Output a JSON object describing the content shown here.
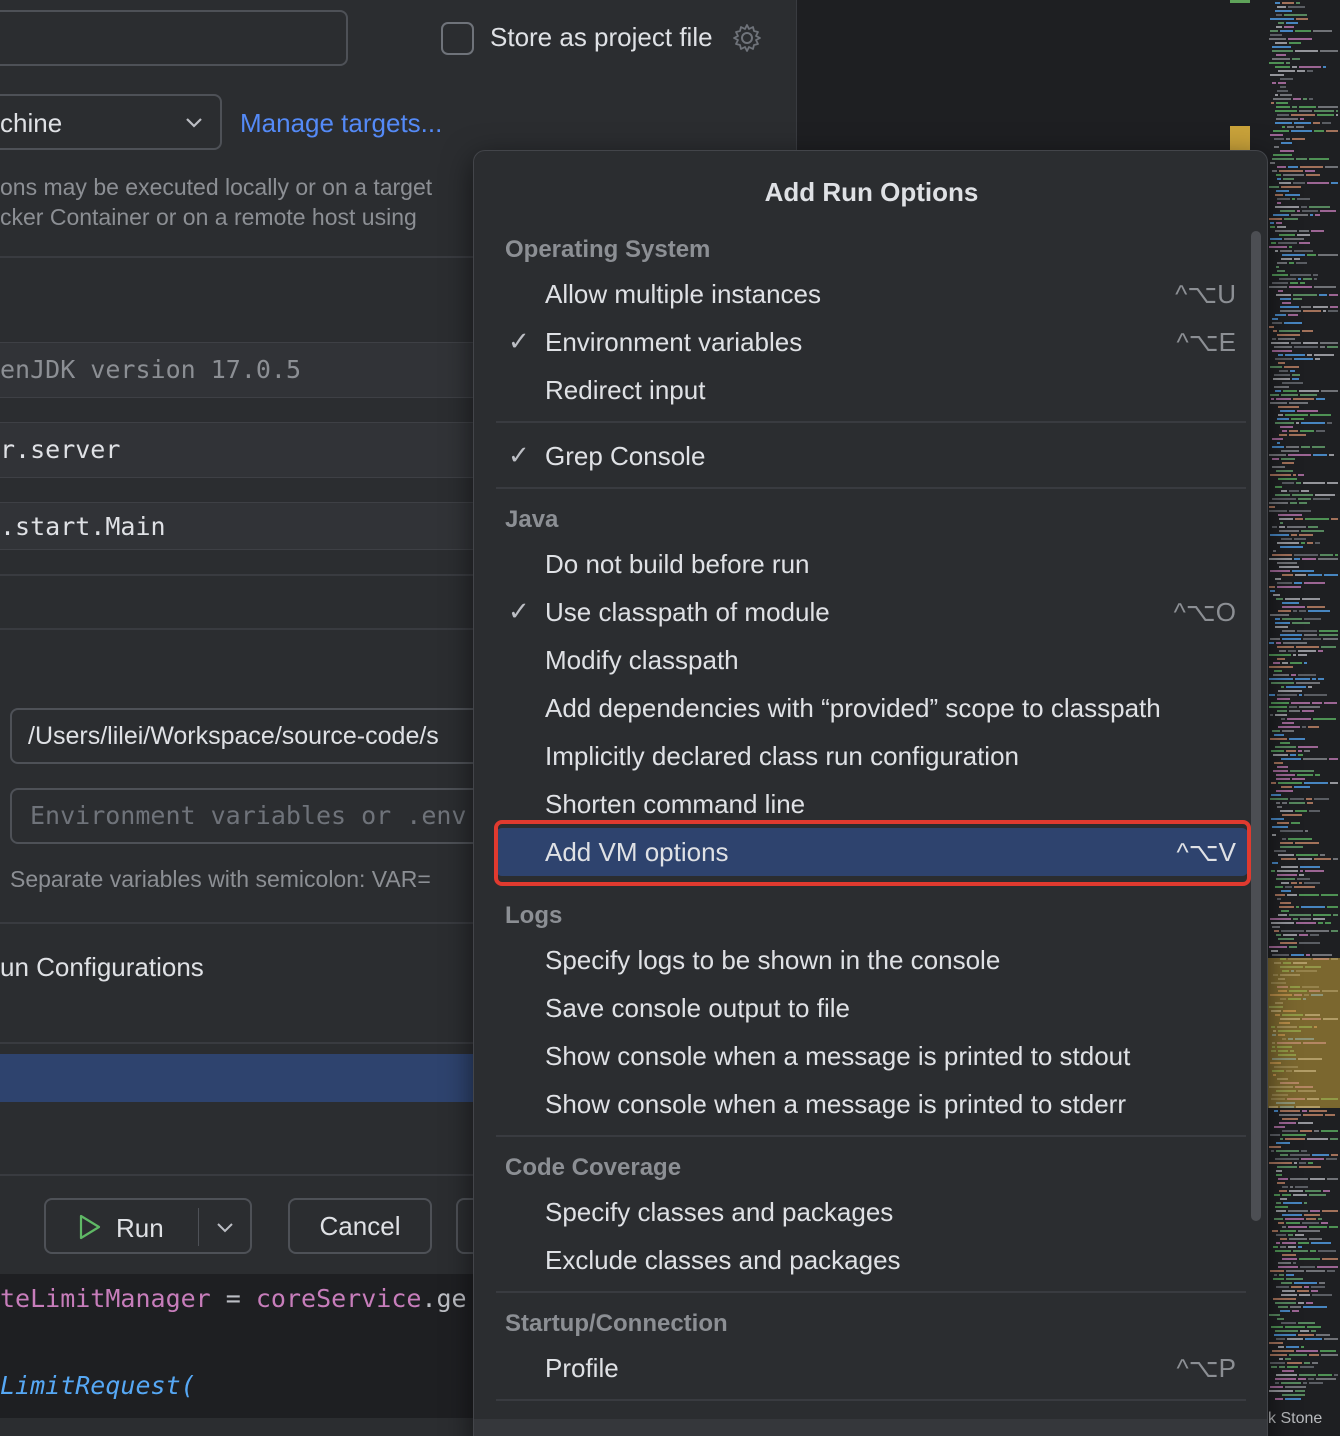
{
  "dialog": {
    "store_label": "Store as project file",
    "target_value": "chine",
    "manage_link": "Manage targets...",
    "desc_line1": "ons may be executed locally or on a target",
    "desc_line2": "cker Container or on a remote host using",
    "jdk": "enJDK version 17.0.5",
    "module": "r.server",
    "main_class": ".start.Main",
    "working_dir": "/Users/lilei/Workspace/source-code/s",
    "env_placeholder": "Environment variables or .env",
    "env_hint": "Separate variables with semicolon: VAR=",
    "run_configs_label": "un Configurations",
    "run_label": "Run",
    "cancel_label": "Cancel"
  },
  "editor": {
    "line1_field": "teLimitManager",
    "line1_op": " = ",
    "line1_call": "coreService",
    "line1_rest": ".ge",
    "line2": "LimitRequest("
  },
  "popup": {
    "title": "Add Run Options",
    "groups": {
      "os": "Operating System",
      "java": "Java",
      "logs": "Logs",
      "coverage": "Code Coverage",
      "startup": "Startup/Connection"
    },
    "items": {
      "allow_multiple": {
        "label": "Allow multiple instances",
        "shortcut": "^⌥U",
        "checked": false
      },
      "env_vars": {
        "label": "Environment variables",
        "shortcut": "^⌥E",
        "checked": true
      },
      "redirect_input": {
        "label": "Redirect input",
        "shortcut": "",
        "checked": false
      },
      "grep_console": {
        "label": "Grep Console",
        "shortcut": "",
        "checked": true
      },
      "no_build": {
        "label": "Do not build before run",
        "shortcut": "",
        "checked": false
      },
      "use_classpath": {
        "label": "Use classpath of module",
        "shortcut": "^⌥O",
        "checked": true
      },
      "modify_classpath": {
        "label": "Modify classpath",
        "shortcut": "",
        "checked": false
      },
      "provided_scope": {
        "label": "Add dependencies with “provided” scope to classpath",
        "shortcut": "",
        "checked": false
      },
      "implicit_class": {
        "label": "Implicitly declared class run configuration",
        "shortcut": "",
        "checked": false
      },
      "shorten_cmd": {
        "label": "Shorten command line",
        "shortcut": "",
        "checked": false
      },
      "vm_options": {
        "label": "Add VM options",
        "shortcut": "^⌥V",
        "checked": false,
        "highlighted": true
      },
      "logs_console": {
        "label": "Specify logs to be shown in the console",
        "shortcut": "",
        "checked": false
      },
      "save_output": {
        "label": "Save console output to file",
        "shortcut": "",
        "checked": false
      },
      "stdout": {
        "label": "Show console when a message is printed to stdout",
        "shortcut": "",
        "checked": false
      },
      "stderr": {
        "label": "Show console when a message is printed to stderr",
        "shortcut": "",
        "checked": false
      },
      "specify_classes": {
        "label": "Specify classes and packages",
        "shortcut": "",
        "checked": false
      },
      "exclude_classes": {
        "label": "Exclude classes and packages",
        "shortcut": "",
        "checked": false
      },
      "profile": {
        "label": "Profile",
        "shortcut": "^⌥P",
        "checked": false
      }
    },
    "checkmark": "✓"
  },
  "watermark": "CSDN @Stack Stone",
  "colors": {
    "accent_link": "#548af7",
    "selection": "#2e436e",
    "annotation_red": "#e03a2f"
  }
}
